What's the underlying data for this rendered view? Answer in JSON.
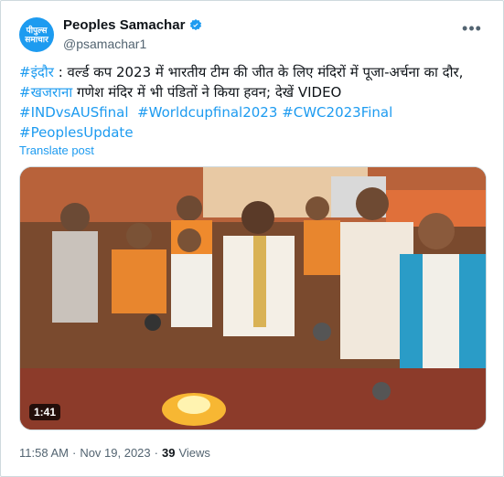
{
  "account": {
    "avatar_text": "पीपुल्स समाचार",
    "display_name": "Peoples Samachar",
    "handle": "@psamachar1",
    "more_icon": "more-horizontal-icon",
    "verified_icon": "verified-badge-icon",
    "brand_color": "#1d9bf0"
  },
  "tweet": {
    "line1_hashtag": "#इंदौर",
    "line1_text": " : वर्ल्ड कप 2023 में भारतीय टीम की जीत के लिए मंदिरों में पूजा-अर्चना का दौर,",
    "line2_hashtag": "#खजराना",
    "line2_text": " गणेश मंदिर में भी पंडितों ने किया हवन; देखें VIDEO",
    "tags": [
      "#INDvsAUSfinal",
      "#Worldcupfinal2023",
      "#CWC2023Final",
      "#PeoplesUpdate"
    ],
    "translate_label": "Translate post"
  },
  "media": {
    "type": "video",
    "duration": "1:41"
  },
  "footer": {
    "time": "11:58 AM",
    "separator": "·",
    "date": "Nov 19, 2023",
    "views_count": "39",
    "views_label": "Views"
  }
}
